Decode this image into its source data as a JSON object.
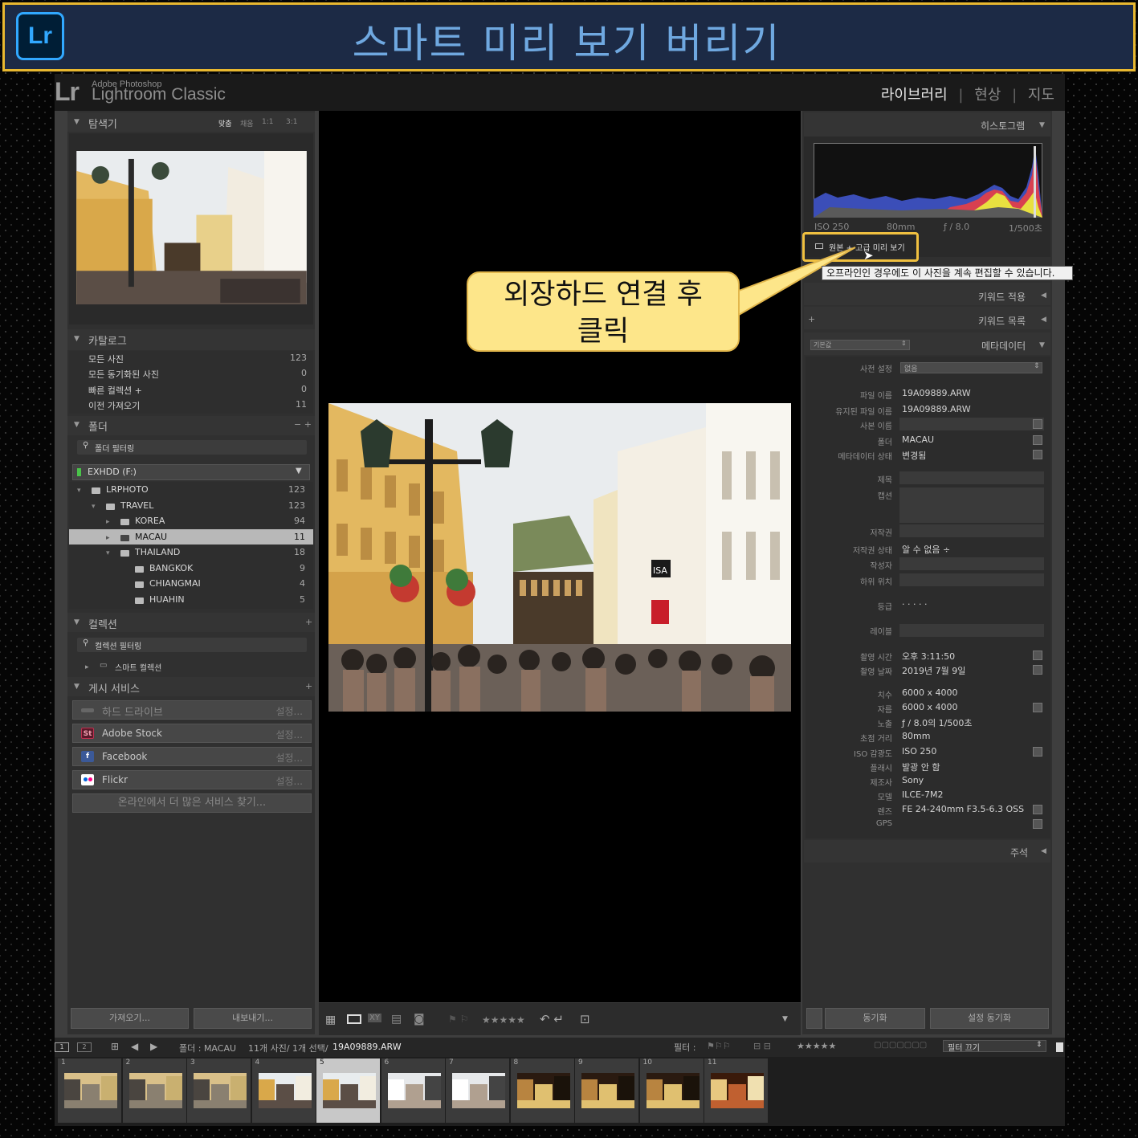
{
  "banner": {
    "title": "스마트 미리 보기 버리기",
    "badge": "Lr"
  },
  "app": {
    "brand_small": "Adobe Photoshop",
    "brand_big": "Lightroom Classic",
    "logo": "Lr",
    "modules": [
      "라이브러리",
      "현상",
      "지도"
    ],
    "module_sep": "|"
  },
  "navigator": {
    "title": "탐색기",
    "zoom": [
      "맞춤",
      "채움",
      "1:1",
      "3:1"
    ]
  },
  "catalog": {
    "title": "카탈로그",
    "items": [
      {
        "label": "모든 사진",
        "count": "123"
      },
      {
        "label": "모든 동기화된 사진",
        "count": "0"
      },
      {
        "label": "빠른 컬렉션 +",
        "count": "0"
      },
      {
        "label": "이전 가져오기",
        "count": "11"
      }
    ]
  },
  "folders": {
    "title": "폴더",
    "actions": "− +",
    "filter_placeholder": "폴더 필터링",
    "drive": "EXHDD (F:)",
    "tree": [
      {
        "label": "LRPHOTO",
        "count": "123",
        "level": 0
      },
      {
        "label": "TRAVEL",
        "count": "123",
        "level": 1
      },
      {
        "label": "KOREA",
        "count": "94",
        "level": 2
      },
      {
        "label": "MACAU",
        "count": "11",
        "level": 2,
        "selected": true
      },
      {
        "label": "THAILAND",
        "count": "18",
        "level": 2
      },
      {
        "label": "BANGKOK",
        "count": "9",
        "level": 3
      },
      {
        "label": "CHIANGMAI",
        "count": "4",
        "level": 3
      },
      {
        "label": "HUAHIN",
        "count": "5",
        "level": 3
      }
    ]
  },
  "collections": {
    "title": "컬렉션",
    "filter_placeholder": "컬렉션 필터링",
    "smart": "스마트 컬렉션",
    "add": "+"
  },
  "publish": {
    "title": "게시 서비스",
    "add": "+",
    "services": [
      {
        "label": "하드 드라이브",
        "setting": "설정...",
        "icon": "hard-drive-icon"
      },
      {
        "label": "Adobe Stock",
        "setting": "설정...",
        "icon": "St"
      },
      {
        "label": "Facebook",
        "setting": "설정...",
        "icon": "f"
      },
      {
        "label": "Flickr",
        "setting": "설정...",
        "icon": "flickr-icon"
      }
    ],
    "find_more": "온라인에서 더 많은 서비스 찾기..."
  },
  "left_buttons": {
    "import": "가져오기...",
    "export": "내보내기..."
  },
  "histogram": {
    "title": "히스토그램",
    "iso": "ISO 250",
    "focal": "80mm",
    "aperture": "ƒ / 8.0",
    "shutter": "1/500초",
    "preview_status": "원본 + 고급 미리 보기"
  },
  "tooltip": "오프라인인 경우에도 이 사진을 계속 편집할 수 있습니다.",
  "callout": {
    "line1": "외장하드 연결 후",
    "line2": "클릭"
  },
  "right_panels": {
    "keywording": "키워드 적용",
    "keyword_list": "키워드 목록",
    "metadata": "메타데이터",
    "preset": "기본값",
    "comments": "주석",
    "add": "+"
  },
  "metadata": {
    "preset_label": "사전 설정",
    "preset_value": "없음",
    "fields": [
      {
        "label": "파일 이름",
        "value": "19A09889.ARW"
      },
      {
        "label": "유지된 파일 이름",
        "value": "19A09889.ARW"
      },
      {
        "label": "사본 이름",
        "value": ""
      },
      {
        "label": "폴더",
        "value": "MACAU"
      },
      {
        "label": "메타데이터 상태",
        "value": "변경됨"
      }
    ],
    "iptc": [
      {
        "label": "제목",
        "value": ""
      },
      {
        "label": "캡션",
        "value": ""
      },
      {
        "label": "저작권",
        "value": ""
      },
      {
        "label": "저작권 상태",
        "value": "알 수 없음 ÷"
      },
      {
        "label": "작성자",
        "value": ""
      },
      {
        "label": "하위 위치",
        "value": ""
      }
    ],
    "rating_label": "등급",
    "rating_value": "· · · · ·",
    "label_label": "레이블",
    "capture": [
      {
        "label": "촬영 시간",
        "value": "오후 3:11:50"
      },
      {
        "label": "촬영 날짜",
        "value": "2019년 7월 9일"
      }
    ],
    "exif": [
      {
        "label": "치수",
        "value": "6000 x 4000"
      },
      {
        "label": "자름",
        "value": "6000 x 4000"
      },
      {
        "label": "노출",
        "value": "ƒ / 8.0의 1/500초"
      },
      {
        "label": "초점 거리",
        "value": "80mm"
      },
      {
        "label": "ISO 감광도",
        "value": "ISO 250"
      },
      {
        "label": "플래시",
        "value": "발광 안 함"
      },
      {
        "label": "제조사",
        "value": "Sony"
      },
      {
        "label": "모델",
        "value": "ILCE-7M2"
      },
      {
        "label": "렌즈",
        "value": "FE 24-240mm F3.5-6.3 OSS"
      },
      {
        "label": "GPS",
        "value": ""
      }
    ]
  },
  "right_buttons": {
    "sync": "동기화",
    "sync_settings": "설정 동기화"
  },
  "toolbar": {
    "stars": "★★★★★"
  },
  "filmstrip_bar": {
    "source": "폴더 : MACAU",
    "count": "11개 사진/ 1개 선택/",
    "file": "19A09889.ARW",
    "filter_label": "필터 :",
    "filter_stars": "★★★★★",
    "filter_off": "필터 끄기",
    "views": [
      "1",
      "2"
    ]
  },
  "filmstrip": {
    "thumbs": [
      {
        "num": "1",
        "tone": "street"
      },
      {
        "num": "2",
        "tone": "street"
      },
      {
        "num": "3",
        "tone": "street"
      },
      {
        "num": "4",
        "tone": "square"
      },
      {
        "num": "5",
        "tone": "square",
        "selected": true
      },
      {
        "num": "6",
        "tone": "cars"
      },
      {
        "num": "7",
        "tone": "cars"
      },
      {
        "num": "8",
        "tone": "hall"
      },
      {
        "num": "9",
        "tone": "hall"
      },
      {
        "num": "10",
        "tone": "hall"
      },
      {
        "num": "11",
        "tone": "chandelier"
      }
    ]
  }
}
